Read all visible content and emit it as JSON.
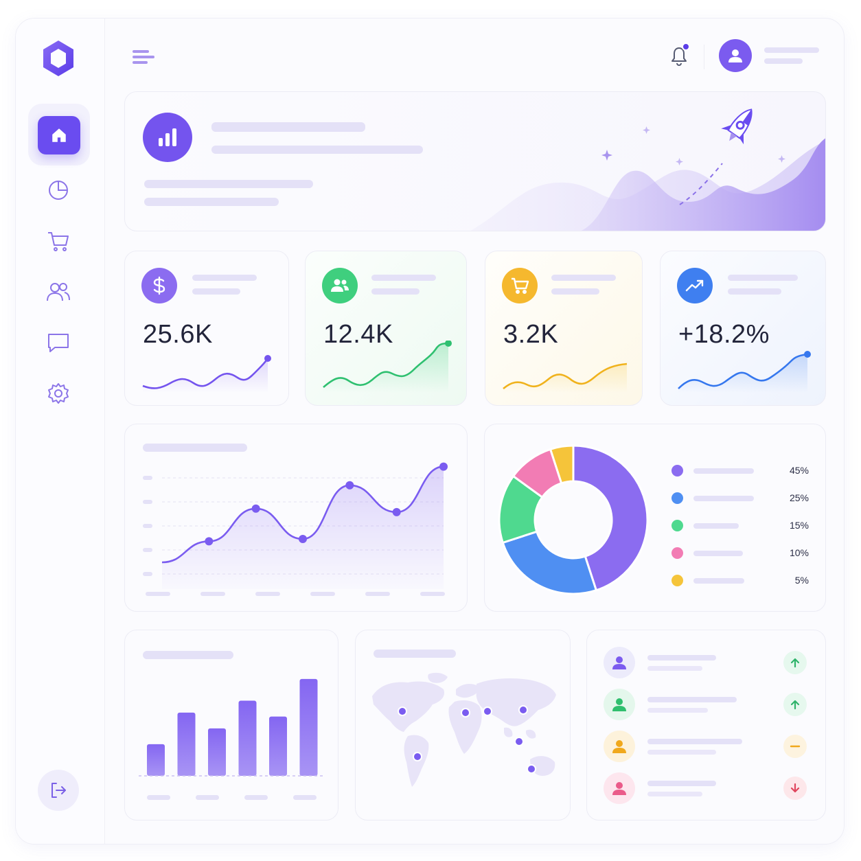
{
  "colors": {
    "accent": "#6a4cf0",
    "purple": "#8b6cf0",
    "green": "#3fcf7e",
    "yellow": "#f5b82e",
    "blue": "#3f7ff0",
    "pink": "#f27cb4"
  },
  "sidebar": {
    "logo_icon": "hexagon-logo",
    "items": [
      {
        "icon": "home-icon",
        "active": true
      },
      {
        "icon": "pie-chart-icon",
        "active": false
      },
      {
        "icon": "cart-icon",
        "active": false
      },
      {
        "icon": "users-icon",
        "active": false
      },
      {
        "icon": "chat-icon",
        "active": false
      },
      {
        "icon": "gear-icon",
        "active": false
      }
    ],
    "logout_icon": "logout-icon"
  },
  "topbar": {
    "menu_icon": "menu-icon",
    "notification_icon": "bell-icon",
    "has_notification": true,
    "avatar_icon": "user-icon"
  },
  "hero": {
    "icon": "bar-chart-icon",
    "illustration": "rocket-icon"
  },
  "stats": [
    {
      "value": "25.6K",
      "icon": "dollar-icon",
      "color": "#8b6cf0"
    },
    {
      "value": "12.4K",
      "icon": "users-icon",
      "color": "#3fcf7e"
    },
    {
      "value": "3.2K",
      "icon": "cart-icon",
      "color": "#f5b82e"
    },
    {
      "value": "+18.2%",
      "icon": "trend-up-icon",
      "color": "#3f7ff0"
    }
  ],
  "line_chart": {
    "chart_data": {
      "type": "line",
      "x": [
        1,
        2,
        3,
        4,
        5,
        6,
        7
      ],
      "values": [
        10,
        28,
        56,
        30,
        76,
        53,
        92
      ],
      "ylim": [
        0,
        100
      ]
    }
  },
  "donut": {
    "chart_data": {
      "type": "pie",
      "categories": [
        "",
        "",
        "",
        "",
        ""
      ],
      "values": [
        45,
        25,
        15,
        10,
        5
      ],
      "colors": [
        "#8b6cf0",
        "#4f8ff2",
        "#4fd98f",
        "#f27cb4",
        "#f5c43a"
      ]
    },
    "legend": [
      {
        "pct": "45%",
        "color": "#8b6cf0"
      },
      {
        "pct": "25%",
        "color": "#4f8ff2"
      },
      {
        "pct": "15%",
        "color": "#4fd98f"
      },
      {
        "pct": "10%",
        "color": "#f27cb4"
      },
      {
        "pct": "5%",
        "color": "#f5c43a"
      }
    ]
  },
  "bar_chart": {
    "chart_data": {
      "type": "bar",
      "categories": [
        "",
        "",
        "",
        "",
        "",
        ""
      ],
      "values": [
        32,
        64,
        48,
        76,
        60,
        98
      ],
      "ylim": [
        0,
        100
      ]
    }
  },
  "map": {
    "icon": "world-map-icon",
    "markers": 7
  },
  "activity": [
    {
      "color": "#7b5bef",
      "bg": "#ecebfb",
      "trend": "up",
      "trend_icon": "arrow-up-icon",
      "trend_color": "#2fb36a",
      "trend_bg": "#e6f8ee"
    },
    {
      "color": "#2fbf6e",
      "bg": "#e4f7ec",
      "trend": "up",
      "trend_icon": "arrow-up-icon",
      "trend_color": "#2fb36a",
      "trend_bg": "#e6f8ee"
    },
    {
      "color": "#f0a81c",
      "bg": "#fdf2db",
      "trend": "flat",
      "trend_icon": "minus-icon",
      "trend_color": "#f0a81c",
      "trend_bg": "#fdf3df"
    },
    {
      "color": "#ea5b8a",
      "bg": "#fde6ee",
      "trend": "down",
      "trend_icon": "arrow-down-icon",
      "trend_color": "#e0455d",
      "trend_bg": "#fde7ea"
    }
  ]
}
